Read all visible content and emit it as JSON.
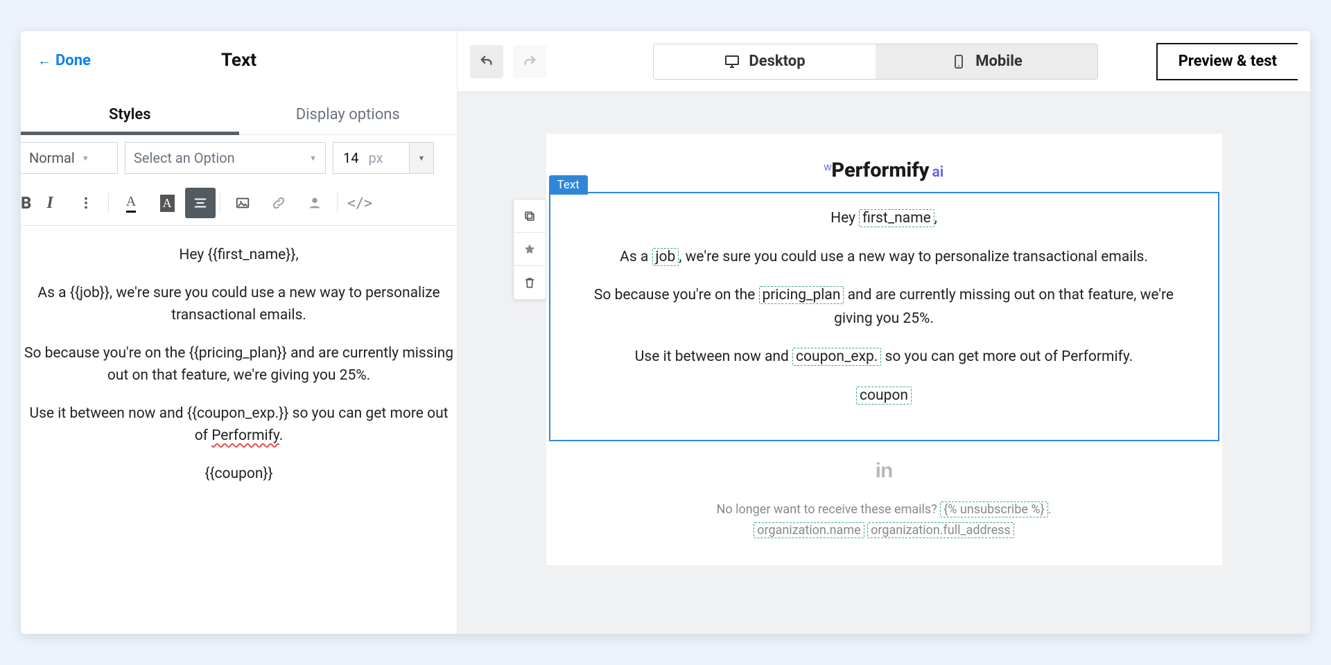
{
  "left": {
    "done": "Done",
    "title": "Text",
    "tabs": {
      "styles": "Styles",
      "display": "Display options"
    },
    "format": {
      "normal": "Normal",
      "select_option": "Select an Option",
      "size_val": "14",
      "size_unit": "px"
    },
    "editor": {
      "p1_pre": "Hey ",
      "p1_var": "{{first_name}}",
      "p1_post": ",",
      "p2_pre": "As a ",
      "p2_var": "{{job}}",
      "p2_post": ", we're sure you could use a new way to personalize transactional emails.",
      "p3_pre": "So because you're on the ",
      "p3_var": "{{pricing_plan}}",
      "p3_post": " and are currently missing out on that feature, we're giving you 25%.",
      "p4_pre": "Use it between now and ",
      "p4_var": "{{coupon_exp.}}",
      "p4_mid": " so you can get more out of ",
      "p4_perf": "Performify",
      "p4_post": ".",
      "p5_var": "{{coupon}}"
    }
  },
  "right": {
    "desktop": "Desktop",
    "mobile": "Mobile",
    "preview": "Preview & test",
    "block_tag": "Text",
    "brand": {
      "spark": "ᴹ",
      "name": "Performify",
      "ai": "ai"
    },
    "body": {
      "p1_pre": "Hey ",
      "p1_var": "first_name",
      "p1_post": ",",
      "p2_pre": "As a ",
      "p2_var": "job",
      "p2_post": ", we're sure you could use a new way to personalize transactional emails.",
      "p3_pre": "So because you're on the ",
      "p3_var": "pricing_plan",
      "p3_post": " and are currently missing out on that feature, we're giving you 25%.",
      "p4_pre": "Use it between now and ",
      "p4_var": "coupon_exp.",
      "p4_post": " so you can get more out of Performify.",
      "p5_var": "coupon"
    },
    "footer": {
      "line1_pre": "No longer want to receive these emails? ",
      "unsub": "{% unsubscribe %}",
      "line1_post": ".",
      "org_name": "organization.name",
      "org_addr": "organization.full_address"
    }
  }
}
